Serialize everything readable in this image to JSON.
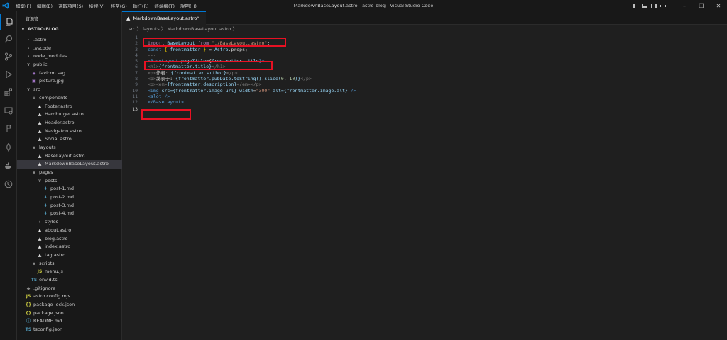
{
  "menu": [
    "檔案(F)",
    "編輯(E)",
    "選取項目(S)",
    "檢視(V)",
    "移至(G)",
    "執行(R)",
    "終端機(T)",
    "說明(H)"
  ],
  "window_title": "MarkdownBaseLayout.astro - astro-blog - Visual Studio Code",
  "explorer": {
    "title": "資源管",
    "more": "···",
    "root": "ASTRO-BLOG",
    "items": [
      {
        "label": ".astro",
        "depth": 1,
        "kind": "folder",
        "open": false
      },
      {
        "label": ".vscode",
        "depth": 1,
        "kind": "folder",
        "open": false
      },
      {
        "label": "node_modules",
        "depth": 1,
        "kind": "folder",
        "open": false
      },
      {
        "label": "public",
        "depth": 1,
        "kind": "folder",
        "open": true
      },
      {
        "label": "favicon.svg",
        "depth": 2,
        "kind": "svg"
      },
      {
        "label": "picture.jpg",
        "depth": 2,
        "kind": "img"
      },
      {
        "label": "src",
        "depth": 1,
        "kind": "folder",
        "open": true
      },
      {
        "label": "components",
        "depth": 2,
        "kind": "folder",
        "open": true
      },
      {
        "label": "Footer.astro",
        "depth": 3,
        "kind": "astro"
      },
      {
        "label": "Hamburger.astro",
        "depth": 3,
        "kind": "astro"
      },
      {
        "label": "Header.astro",
        "depth": 3,
        "kind": "astro"
      },
      {
        "label": "Navigaton.astro",
        "depth": 3,
        "kind": "astro"
      },
      {
        "label": "Social.astro",
        "depth": 3,
        "kind": "astro"
      },
      {
        "label": "layouts",
        "depth": 2,
        "kind": "folder",
        "open": true
      },
      {
        "label": "BaseLayout.astro",
        "depth": 3,
        "kind": "astro"
      },
      {
        "label": "MarkdownBaseLayout.astro",
        "depth": 3,
        "kind": "astro",
        "selected": true
      },
      {
        "label": "pages",
        "depth": 2,
        "kind": "folder",
        "open": true
      },
      {
        "label": "posts",
        "depth": 3,
        "kind": "folder",
        "open": true
      },
      {
        "label": "post-1.md",
        "depth": 4,
        "kind": "md"
      },
      {
        "label": "post-2.md",
        "depth": 4,
        "kind": "md"
      },
      {
        "label": "post-3.md",
        "depth": 4,
        "kind": "md"
      },
      {
        "label": "post-4.md",
        "depth": 4,
        "kind": "md"
      },
      {
        "label": "styles",
        "depth": 3,
        "kind": "folder",
        "open": false
      },
      {
        "label": "about.astro",
        "depth": 3,
        "kind": "astro"
      },
      {
        "label": "blog.astro",
        "depth": 3,
        "kind": "astro"
      },
      {
        "label": "index.astro",
        "depth": 3,
        "kind": "astro"
      },
      {
        "label": "tag.astro",
        "depth": 3,
        "kind": "astro"
      },
      {
        "label": "scripts",
        "depth": 2,
        "kind": "folder",
        "open": true
      },
      {
        "label": "menu.js",
        "depth": 3,
        "kind": "js"
      },
      {
        "label": "env.d.ts",
        "depth": 2,
        "kind": "ts"
      },
      {
        "label": ".gitignore",
        "depth": 1,
        "kind": "git"
      },
      {
        "label": "astro.config.mjs",
        "depth": 1,
        "kind": "js"
      },
      {
        "label": "package-lock.json",
        "depth": 1,
        "kind": "json"
      },
      {
        "label": "package.json",
        "depth": 1,
        "kind": "json"
      },
      {
        "label": "README.md",
        "depth": 1,
        "kind": "info"
      },
      {
        "label": "tsconfig.json",
        "depth": 1,
        "kind": "ts"
      }
    ]
  },
  "tab": {
    "label": "MarkdownBaseLayout.astro",
    "close": "×"
  },
  "breadcrumb": "src 〉 layouts 〉 MarkdownBaseLayout.astro 〉 ...",
  "code_lines": [
    {
      "n": "1",
      "tokens": [
        {
          "t": "---",
          "c": "t-dim"
        }
      ]
    },
    {
      "n": "2",
      "tokens": [
        {
          "t": "import ",
          "c": "t-kw"
        },
        {
          "t": "BaseLayout",
          "c": "t-id"
        },
        {
          "t": " from ",
          "c": "t-kw"
        },
        {
          "t": "\"./BaseLayout.astro\"",
          "c": "t-str"
        },
        {
          "t": ";",
          "c": "t-txt"
        }
      ]
    },
    {
      "n": "3",
      "tokens": [
        {
          "t": "const ",
          "c": "t-kw2"
        },
        {
          "t": "{ ",
          "c": "t-brk"
        },
        {
          "t": "frontmatter",
          "c": "t-id"
        },
        {
          "t": " }",
          "c": "t-brk"
        },
        {
          "t": " = ",
          "c": "t-txt"
        },
        {
          "t": "Astro",
          "c": "t-id"
        },
        {
          "t": ".props;",
          "c": "t-txt"
        }
      ]
    },
    {
      "n": "4",
      "tokens": [
        {
          "t": "---",
          "c": "t-dim"
        }
      ]
    },
    {
      "n": "5",
      "tokens": [
        {
          "t": "<BaseLayout ",
          "c": "t-tag"
        },
        {
          "t": "pageTitle",
          "c": "t-attr"
        },
        {
          "t": "={",
          "c": "t-txt"
        },
        {
          "t": "frontmatter",
          "c": "t-id"
        },
        {
          "t": ".",
          "c": "t-txt"
        },
        {
          "t": "title",
          "c": "t-id"
        },
        {
          "t": "}>",
          "c": "t-tag"
        }
      ]
    },
    {
      "n": "6",
      "tokens": [
        {
          "t": "<h1>",
          "c": "t-dim"
        },
        {
          "t": "{frontmatter.title}",
          "c": "t-id"
        },
        {
          "t": "</h1>",
          "c": "t-dim"
        }
      ]
    },
    {
      "n": "7",
      "tokens": [
        {
          "t": "<p>",
          "c": "t-dim"
        },
        {
          "t": "作者: ",
          "c": "t-txt"
        },
        {
          "t": "{frontmatter.author}",
          "c": "t-id"
        },
        {
          "t": "</p>",
          "c": "t-dim"
        }
      ]
    },
    {
      "n": "8",
      "tokens": [
        {
          "t": "<p>",
          "c": "t-dim"
        },
        {
          "t": "发表于: ",
          "c": "t-txt"
        },
        {
          "t": "{frontmatter.pubDate.toString().slice(",
          "c": "t-id"
        },
        {
          "t": "0",
          "c": "t-num"
        },
        {
          "t": ", ",
          "c": "t-txt"
        },
        {
          "t": "10",
          "c": "t-num"
        },
        {
          "t": ")}",
          "c": "t-id"
        },
        {
          "t": "</p>",
          "c": "t-dim"
        }
      ]
    },
    {
      "n": "9",
      "tokens": [
        {
          "t": "<p><em>",
          "c": "t-dim"
        },
        {
          "t": "{frontmatter.description}",
          "c": "t-id"
        },
        {
          "t": "</em></p>",
          "c": "t-dim"
        }
      ]
    },
    {
      "n": "10",
      "tokens": [
        {
          "t": "<img ",
          "c": "t-tag"
        },
        {
          "t": "src",
          "c": "t-attr"
        },
        {
          "t": "={frontmatter.image.url} ",
          "c": "t-id"
        },
        {
          "t": "width",
          "c": "t-attr"
        },
        {
          "t": "=",
          "c": "t-txt"
        },
        {
          "t": "\"300\"",
          "c": "t-str"
        },
        {
          "t": " alt",
          "c": "t-attr"
        },
        {
          "t": "={frontmatter.image.alt} ",
          "c": "t-id"
        },
        {
          "t": "/>",
          "c": "t-tag"
        }
      ]
    },
    {
      "n": "11",
      "tokens": [
        {
          "t": "<slot />",
          "c": "t-tag"
        }
      ]
    },
    {
      "n": "12",
      "tokens": [
        {
          "t": "</BaseLayout>",
          "c": "t-tag"
        }
      ]
    },
    {
      "n": "13",
      "tokens": []
    }
  ],
  "colors": {
    "accent": "#0078d4",
    "highlight_box": "#e81123",
    "editor_bg": "#1f1f1f",
    "sidebar_bg": "#181818"
  }
}
